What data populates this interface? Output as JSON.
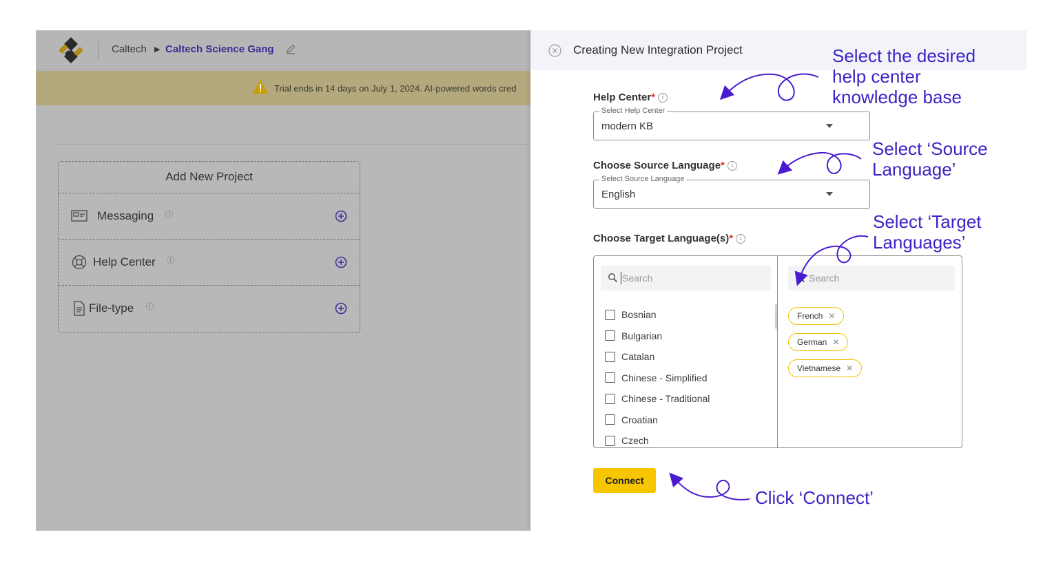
{
  "breadcrumb": {
    "org": "Caltech",
    "project": "Caltech Science Gang"
  },
  "trial_banner": {
    "text": "Trial ends in 14 days on July 1, 2024. AI-powered words cred"
  },
  "project_card": {
    "title": "Add New Project",
    "rows": [
      {
        "label": "Messaging",
        "icon": "messaging-icon"
      },
      {
        "label": "Help Center",
        "icon": "lifebuoy-icon"
      },
      {
        "label": "File-type",
        "icon": "file-icon"
      }
    ]
  },
  "panel": {
    "title": "Creating New Integration Project",
    "help_center": {
      "label": "Help Center",
      "required_mark": "*",
      "select_legend": "Select Help Center",
      "value": "modern KB"
    },
    "source_language": {
      "label": "Choose Source Language",
      "required_mark": "*",
      "select_legend": "Select Source Language",
      "value": "English"
    },
    "target_languages": {
      "label": "Choose Target Language(s)",
      "required_mark": "*",
      "search_placeholder": "Search",
      "selected_search_placeholder": "Search",
      "available": [
        "Bosnian",
        "Bulgarian",
        "Catalan",
        "Chinese - Simplified",
        "Chinese - Traditional",
        "Croatian",
        "Czech"
      ],
      "selected": [
        "French",
        "German",
        "Vietnamese"
      ]
    },
    "connect_label": "Connect"
  },
  "annotations": {
    "help_center": [
      "Select the desired",
      "help center",
      "knowledge base"
    ],
    "source_language": [
      "Select ‘Source",
      "Language’"
    ],
    "target_languages": [
      "Select ‘Target",
      "Languages’"
    ],
    "connect": "Click ‘Connect’"
  },
  "colors": {
    "accent_purple": "#3f2a96",
    "annotation_purple": "#3c25c4",
    "connect_yellow": "#f7c600",
    "chip_border": "#f2c400",
    "required_red": "#d9322b"
  }
}
